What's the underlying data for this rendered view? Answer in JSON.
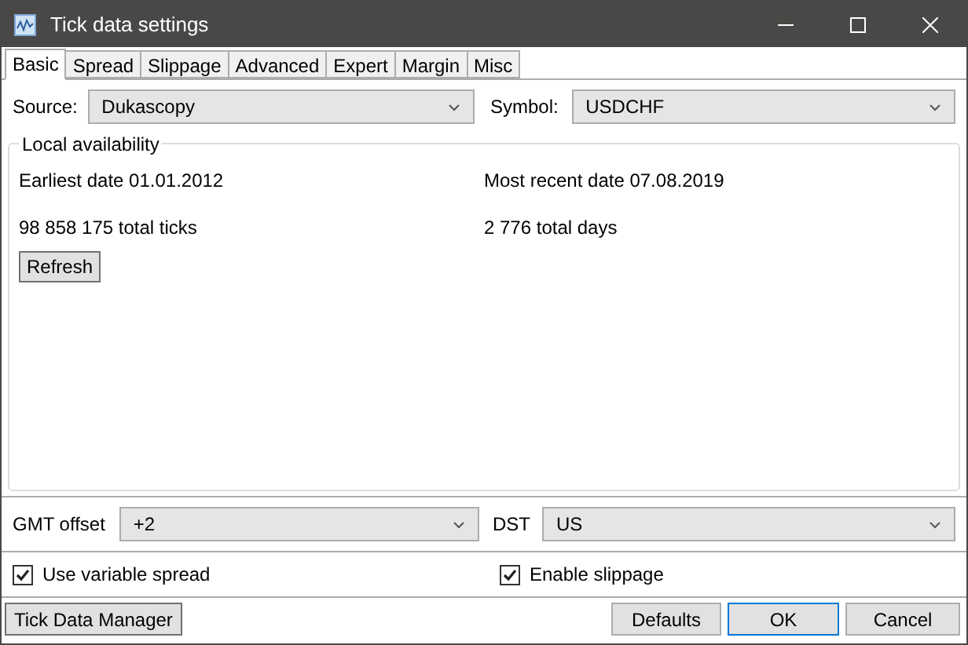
{
  "window": {
    "title": "Tick data settings"
  },
  "tabs": [
    {
      "label": "Basic",
      "selected": true
    },
    {
      "label": "Spread",
      "selected": false
    },
    {
      "label": "Slippage",
      "selected": false
    },
    {
      "label": "Advanced",
      "selected": false
    },
    {
      "label": "Expert",
      "selected": false
    },
    {
      "label": "Margin",
      "selected": false
    },
    {
      "label": "Misc",
      "selected": false
    }
  ],
  "source": {
    "label": "Source:",
    "value": "Dukascopy"
  },
  "symbol": {
    "label": "Symbol:",
    "value": "USDCHF"
  },
  "local_availability": {
    "title": "Local availability",
    "earliest": "Earliest date 01.01.2012",
    "most_recent": "Most recent date 07.08.2019",
    "ticks": "98 858 175 total ticks",
    "days": "2 776 total days",
    "refresh": "Refresh"
  },
  "gmt_offset": {
    "label": "GMT offset",
    "value": "+2"
  },
  "dst": {
    "label": "DST",
    "value": "US"
  },
  "checkboxes": [
    {
      "label": "Use variable spread",
      "checked": true
    },
    {
      "label": "Enable slippage",
      "checked": true
    }
  ],
  "buttons": {
    "manager": "Tick Data Manager",
    "defaults": "Defaults",
    "ok": "OK",
    "cancel": "Cancel"
  }
}
